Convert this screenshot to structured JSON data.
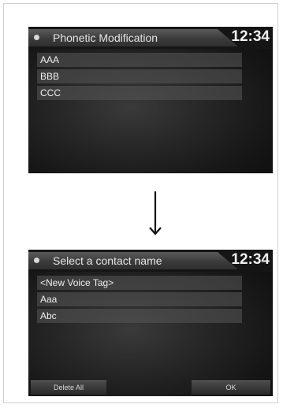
{
  "screen1": {
    "title": "Phonetic Modification",
    "clock": "12:34",
    "items": [
      "AAA",
      "BBB",
      "CCC"
    ]
  },
  "screen2": {
    "title": "Select a contact name",
    "clock": "12:34",
    "items": [
      "<New Voice Tag>",
      "Aaa",
      "Abc"
    ],
    "buttons": {
      "delete_all": "Delete All",
      "ok": "OK"
    }
  },
  "icons": {
    "transition_arrow": "arrow-down-icon",
    "header_dot": "menu-dot-icon"
  },
  "colors": {
    "screen_bg": "#1a1a1a",
    "item_bg": "#4a4a4a",
    "text": "#efefef"
  }
}
